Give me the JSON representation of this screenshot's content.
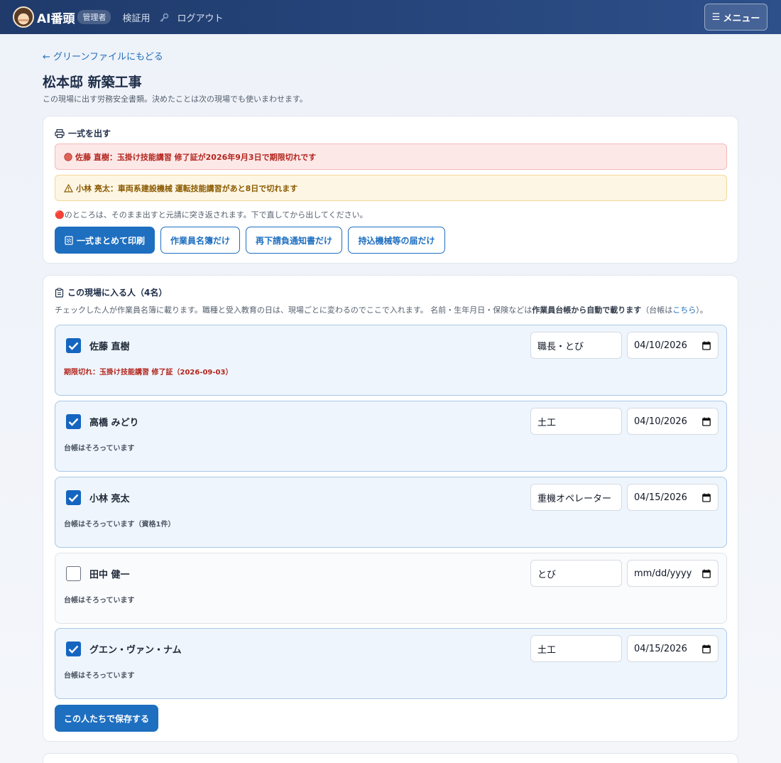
{
  "header": {
    "brand": "AI番頭",
    "role_badge": "管理者",
    "nav_verify": "検証用",
    "nav_logout": "ログアウト",
    "menu_label": "メニュー",
    "menu_icon": "☰"
  },
  "page": {
    "back_link": "← グリーンファイルにもどる",
    "title": "松本邸 新築工事",
    "subtitle": "この現場に出す労務安全書類。決めたことは次の現場でも使いまわせます。"
  },
  "output_card": {
    "heading": "一式を出す",
    "alert_red": "佐藤 直樹：玉掛け技能講習 修了証が2026年9月3日で期限切れです",
    "alert_yellow": "小林 亮太：車両系建設機械 運転技能講習があと8日で切れます",
    "note": "🔴のところは、そのまま出すと元請に突き返されます。下で直してから出してください。",
    "buttons": {
      "print_all": "一式まとめて印刷",
      "roster_only": "作業員名簿だけ",
      "subcontract_only": "再下請負通知書だけ",
      "machine_only": "持込機械等の届だけ"
    }
  },
  "people_card": {
    "heading": "この現場に入る人（4名）",
    "desc_1": "チェックした人が作業員名簿に載ります。職種と受入教育の日は、現場ごとに変わるのでここで入れます。 名前・生年月日・保険などは",
    "desc_bold": "作業員台帳から自動で載ります",
    "desc_2": "（台帳は",
    "desc_link": "こちら",
    "desc_3": "）。",
    "save_button": "この人たちで保存する",
    "people": [
      {
        "name": "佐藤 直樹",
        "checked": true,
        "job": "職長・とび",
        "date": "04/10/2026",
        "status": "期限切れ：玉掛け技能講習 修了証（2026-09-03）",
        "status_type": "error"
      },
      {
        "name": "高橋 みどり",
        "checked": true,
        "job": "土工",
        "date": "04/10/2026",
        "status": "台帳はそろっています",
        "status_type": "ok"
      },
      {
        "name": "小林 亮太",
        "checked": true,
        "job": "重機オペレーター",
        "date": "04/15/2026",
        "status": "台帳はそろっています（資格1件）",
        "status_type": "ok"
      },
      {
        "name": "田中 健一",
        "checked": false,
        "job": "とび",
        "date": "mm/dd/yyyy",
        "status": "台帳はそろっています",
        "status_type": "ok"
      },
      {
        "name": "グエン・ヴァン・ナム",
        "checked": true,
        "job": "土工",
        "date": "04/15/2026",
        "status": "台帳はそろっています",
        "status_type": "ok"
      }
    ]
  },
  "colors": {
    "header_bg": "#1f3a6b",
    "accent": "#1e6fc0",
    "error": "#b3261e",
    "warning": "#8a5a00"
  },
  "icons": {
    "printer": "printer-icon",
    "clipboard": "clipboard-icon",
    "key": "key-icon",
    "error_dot": "red-circle-icon",
    "warning": "warning-icon",
    "calendar": "calendar-icon",
    "check": "check-icon"
  }
}
